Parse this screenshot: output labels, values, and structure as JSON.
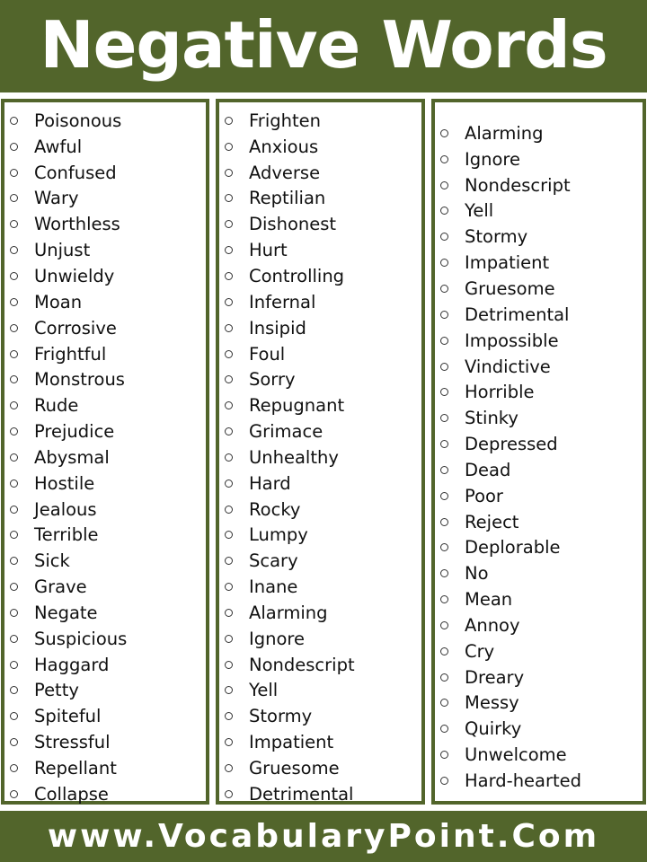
{
  "header": {
    "title": "Negative Words"
  },
  "columns": [
    [
      "Poisonous",
      "Awful",
      "Confused",
      "Wary",
      "Worthless",
      "Unjust",
      "Unwieldy",
      "Moan",
      "Corrosive",
      "Frightful",
      "Monstrous",
      "Rude",
      "Prejudice",
      "Abysmal",
      "Hostile",
      "Jealous",
      "Terrible",
      "Sick",
      "Grave",
      "Negate",
      "Suspicious",
      "Haggard",
      "Petty",
      "Spiteful",
      "Stressful",
      "Repellant",
      "Collapse"
    ],
    [
      "Frighten",
      "Anxious",
      "Adverse",
      "Reptilian",
      "Dishonest",
      "Hurt",
      "Controlling",
      "Infernal",
      "Insipid",
      "Foul",
      "Sorry",
      "Repugnant",
      "Grimace",
      "Unhealthy",
      "Hard",
      "Rocky",
      "Lumpy",
      "Scary",
      "Inane",
      "Alarming",
      "Ignore",
      "Nondescript",
      "Yell",
      "Stormy",
      "Impatient",
      "Gruesome",
      "Detrimental"
    ],
    [
      "Alarming",
      "Ignore",
      "Nondescript",
      "Yell",
      "Stormy",
      "Impatient",
      "Gruesome",
      "Detrimental",
      "Impossible",
      "Vindictive",
      "Horrible",
      "Stinky",
      "Depressed",
      "Dead",
      "Poor",
      "Reject",
      "Deplorable",
      "No",
      "Mean",
      "Annoy",
      "Cry",
      "Dreary",
      "Messy",
      "Quirky",
      "Unwelcome",
      "Hard-hearted"
    ]
  ],
  "footer": {
    "site": "www.VocabularyPoint.Com"
  },
  "colors": {
    "brand": "#52652b",
    "text": "#111111"
  }
}
